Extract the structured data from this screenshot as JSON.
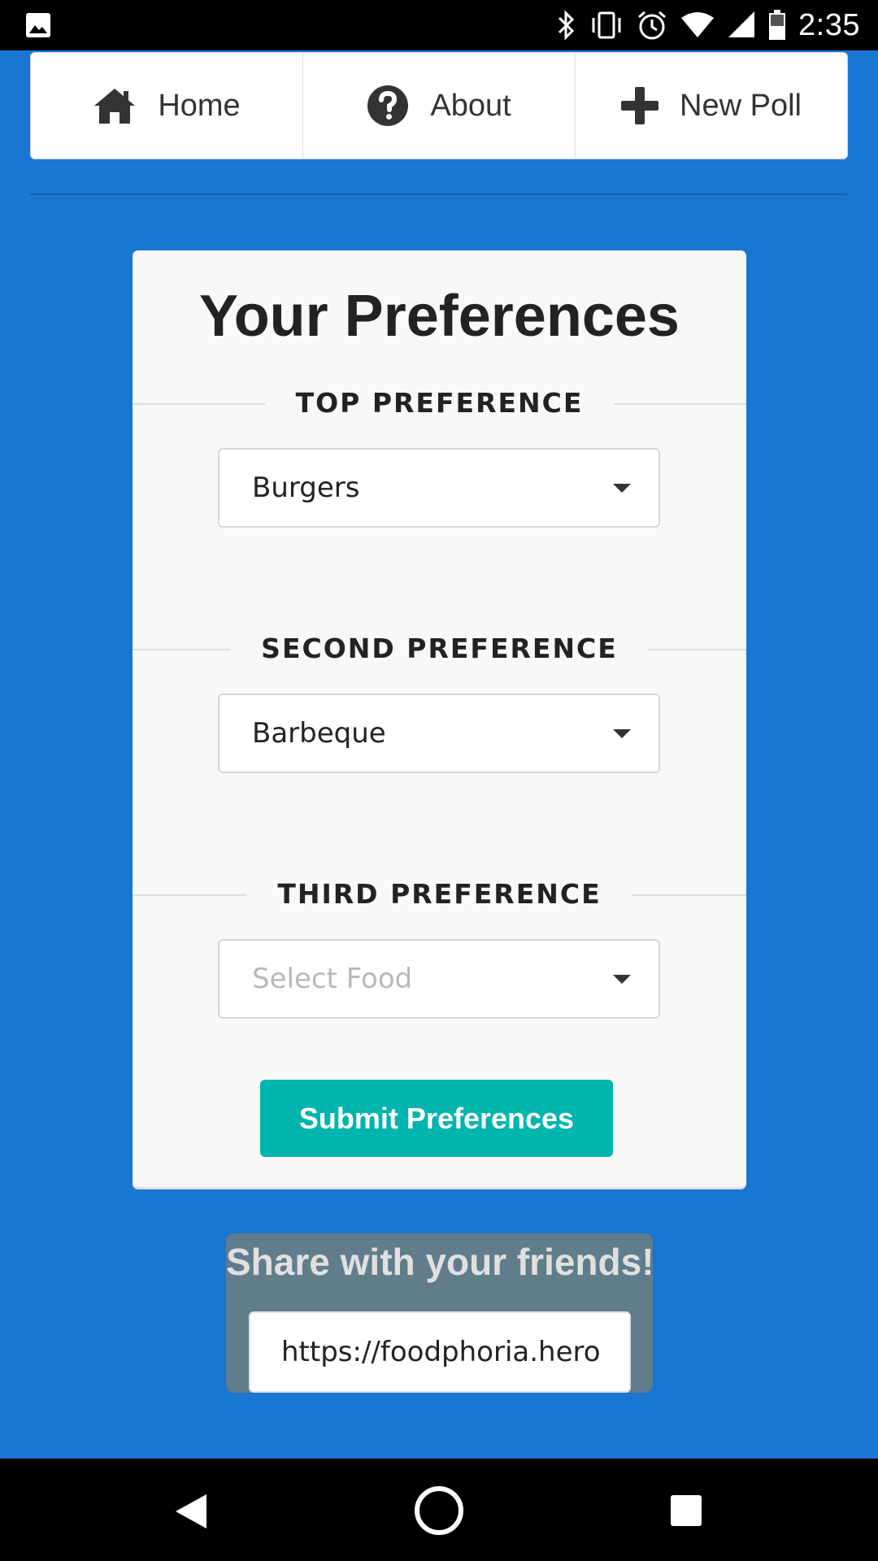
{
  "status_bar": {
    "time": "2:35",
    "icons": [
      "image-icon",
      "bluetooth-icon",
      "vibrate-icon",
      "alarm-icon",
      "wifi-icon",
      "signal-icon",
      "battery-icon"
    ]
  },
  "nav": {
    "items": [
      {
        "label": "Home",
        "icon": "home-icon"
      },
      {
        "label": "About",
        "icon": "question-circle-icon"
      },
      {
        "label": "New Poll",
        "icon": "plus-icon"
      }
    ]
  },
  "card": {
    "title": "Your Preferences",
    "preferences": [
      {
        "label": "TOP PREFERENCE",
        "value": "Burgers",
        "placeholder": false
      },
      {
        "label": "SECOND PREFERENCE",
        "value": "Barbeque",
        "placeholder": false
      },
      {
        "label": "THIRD PREFERENCE",
        "value": "Select Food",
        "placeholder": true
      }
    ],
    "submit_label": "Submit Preferences"
  },
  "share": {
    "title": "Share with your friends!",
    "url": "https://foodphoria.herok"
  },
  "colors": {
    "background": "#1976d2",
    "submit": "#00b5ad",
    "share_box": "#607d8b"
  },
  "android_nav": {
    "icons": [
      "back-icon",
      "home-circle-icon",
      "recents-icon"
    ]
  }
}
